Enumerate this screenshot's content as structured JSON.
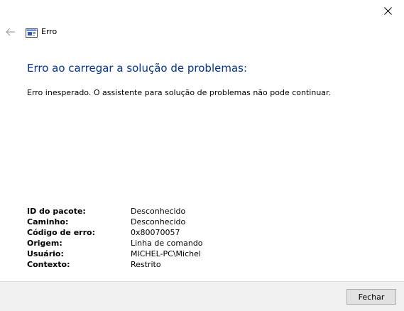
{
  "window": {
    "title": "Erro"
  },
  "content": {
    "heading": "Erro ao carregar a solução de problemas:",
    "message": "Erro inesperado. O assistente para solução de problemas não pode continuar."
  },
  "details": [
    {
      "label": "ID do pacote:",
      "value": "Desconhecido"
    },
    {
      "label": "Caminho:",
      "value": "Desconhecido"
    },
    {
      "label": "Código de erro:",
      "value": "0x80070057"
    },
    {
      "label": "Origem:",
      "value": "Linha de comando"
    },
    {
      "label": "Usuário:",
      "value": "MICHEL-PC\\Michel"
    },
    {
      "label": "Contexto:",
      "value": "Restrito"
    }
  ],
  "footer": {
    "close_label": "Fechar"
  },
  "icons": {
    "close": "close-icon",
    "back": "back-arrow-icon",
    "title": "troubleshooter-icon"
  },
  "colors": {
    "heading": "#003399",
    "footer_bg": "#f0f0f0",
    "button_bg": "#e1e1e1"
  }
}
